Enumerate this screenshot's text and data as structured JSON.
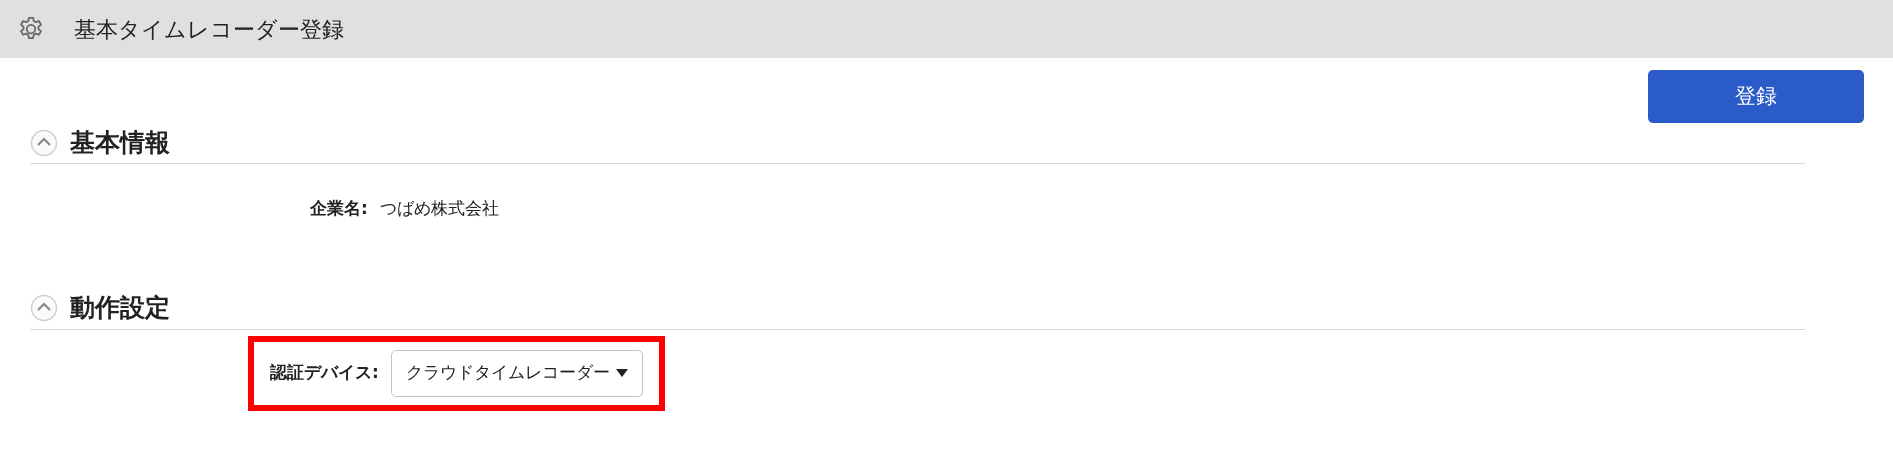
{
  "header": {
    "title": "基本タイムレコーダー登録"
  },
  "register_button": {
    "label": "登録"
  },
  "sections": [
    {
      "title": "基本情報",
      "expanded": true,
      "fields": [
        {
          "kind": "text",
          "label": "企業名:",
          "value": "つばめ株式会社",
          "highlighted": false
        }
      ]
    },
    {
      "title": "動作設定",
      "expanded": true,
      "fields": [
        {
          "kind": "select",
          "label": "認証デバイス:",
          "value": "クラウドタイムレコーダー",
          "highlighted": true
        }
      ]
    }
  ]
}
